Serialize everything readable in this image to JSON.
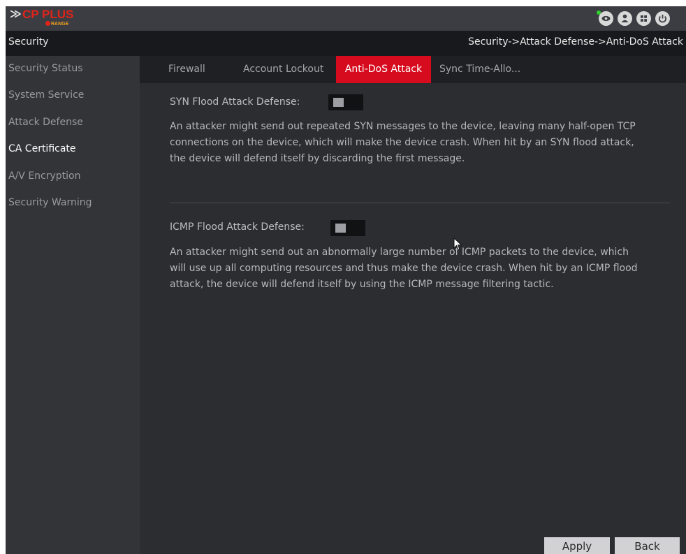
{
  "header": {
    "logo_mark": "≫",
    "logo_brand": "CP PLUS",
    "logo_sub": "RANGE",
    "icons": [
      "eye-icon",
      "user-icon",
      "grid-icon",
      "power-icon"
    ]
  },
  "titlebar": {
    "section": "Security",
    "breadcrumb": "Security->Attack Defense->Anti-DoS Attack"
  },
  "sidebar": {
    "items": [
      {
        "label": "Security Status"
      },
      {
        "label": "System Service"
      },
      {
        "label": "Attack Defense"
      },
      {
        "label": "CA Certificate"
      },
      {
        "label": "A/V Encryption"
      },
      {
        "label": "Security Warning"
      }
    ]
  },
  "tabs": [
    {
      "label": "Firewall"
    },
    {
      "label": "Account Lockout"
    },
    {
      "label": "Anti-DoS Attack"
    },
    {
      "label": "Sync Time-Allo..."
    }
  ],
  "syn": {
    "label": "SYN Flood Attack Defense:",
    "enabled": false,
    "desc_lines": [
      "An attacker might send out repeated SYN messages to the device, leaving many half-open TCP",
      "connections on the device, which will make the device crash. When hit by an SYN flood attack,",
      "the device will defend itself by discarding the first message."
    ]
  },
  "icmp": {
    "label": "ICMP Flood Attack Defense:",
    "enabled": false,
    "desc_lines": [
      "An attacker might send out an abnormally large number of ICMP packets to the device, which",
      "will use up all computing resources and thus make the device crash. When hit by an ICMP flood",
      "attack, the device will defend itself by using the ICMP message filtering tactic."
    ]
  },
  "footer": {
    "apply": "Apply",
    "back": "Back"
  },
  "colors": {
    "accent": "#d70b1e",
    "background": "#2c2d31"
  }
}
